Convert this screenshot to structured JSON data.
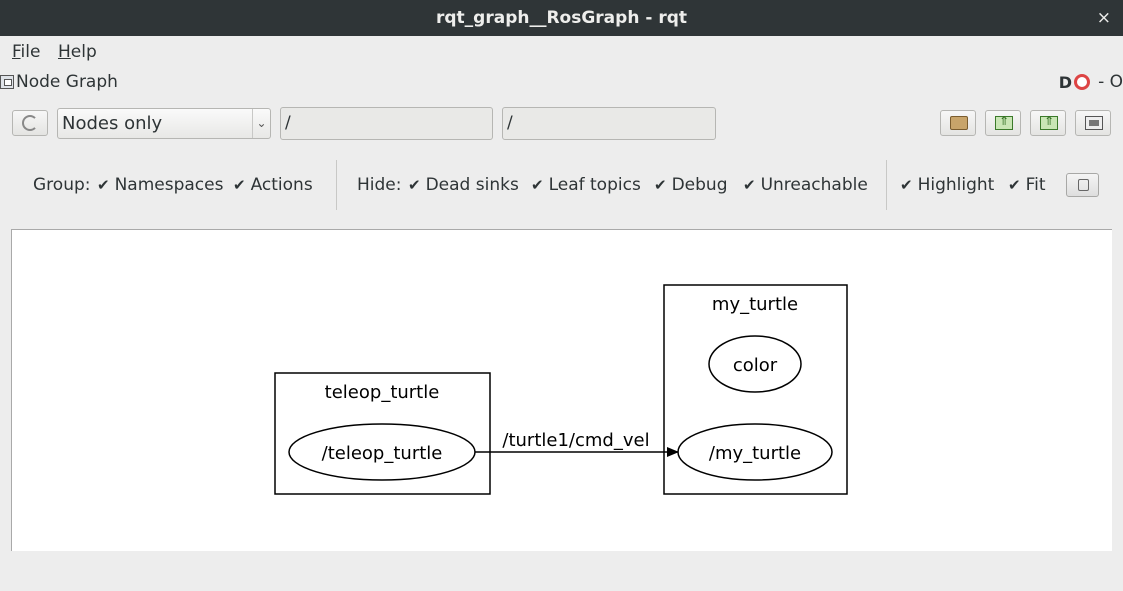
{
  "window": {
    "title": "rqt_graph__RosGraph - rqt",
    "close_glyph": "×"
  },
  "menu": {
    "file": {
      "mnemonic": "F",
      "rest": "ile"
    },
    "help": {
      "mnemonic": "H",
      "rest": "elp"
    }
  },
  "plugin": {
    "title": "Node Graph",
    "dock_d_glyph": "D",
    "dock_dash": "- O"
  },
  "toolbar": {
    "mode_selected": "Nodes only",
    "mode_arrow": "⌄",
    "node_filter": "/",
    "topic_filter": "/"
  },
  "options": {
    "group_label": "Group:",
    "namespaces": {
      "label": "Namespaces",
      "checked": "✔"
    },
    "actions": {
      "label": "Actions",
      "checked": "✔"
    },
    "hide_label": "Hide:",
    "dead_sinks": {
      "label": "Dead sinks",
      "checked": "✔"
    },
    "leaf_topics": {
      "label": "Leaf topics",
      "checked": "✔"
    },
    "debug": {
      "label": "Debug",
      "checked": "✔"
    },
    "unreachable": {
      "label": "Unreachable",
      "checked": "✔"
    },
    "highlight": {
      "label": "Highlight",
      "checked": "✔"
    },
    "fit": {
      "label": "Fit",
      "checked": "✔"
    }
  },
  "graph": {
    "clusters": [
      {
        "label": "teleop_turtle"
      },
      {
        "label": "my_turtle"
      }
    ],
    "nodes": [
      {
        "label": "/teleop_turtle"
      },
      {
        "label": "color"
      },
      {
        "label": "/my_turtle"
      }
    ],
    "edges": [
      {
        "from": "/teleop_turtle",
        "to": "/my_turtle",
        "label": "/turtle1/cmd_vel"
      }
    ]
  }
}
